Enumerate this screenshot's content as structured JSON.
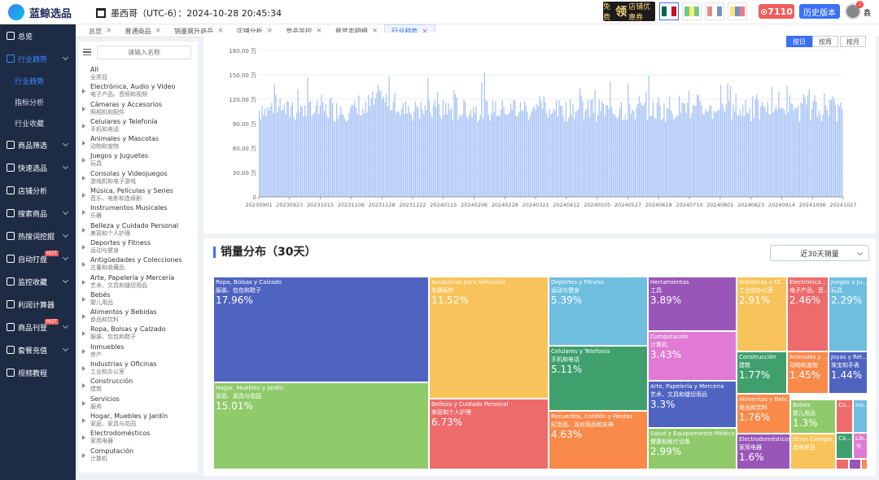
{
  "app": {
    "name": "蓝鲸选品",
    "timezone_text": "墨西哥（UTC-6）：2024-10-28 20:45:34"
  },
  "header": {
    "promo": {
      "left": "免费",
      "big": "领",
      "right": "店铺优惠券"
    },
    "coins": "7110",
    "history_button": "历史版本",
    "user": "鑫",
    "notification_count": "2",
    "flags": [
      {
        "name": "mexico-flag",
        "colors": [
          "#006847",
          "#ffffff",
          "#ce1126"
        ],
        "active": true
      },
      {
        "name": "brazil-flag",
        "colors": [
          "#009c3b",
          "#ffdf00",
          "#009c3b"
        ],
        "active": false
      },
      {
        "name": "chile-flag",
        "colors": [
          "#d52b1e",
          "#ffffff",
          "#0039a6"
        ],
        "active": false
      },
      {
        "name": "colombia-flag",
        "colors": [
          "#fcd116",
          "#003893",
          "#ce1126"
        ],
        "active": false
      }
    ]
  },
  "sidebar": {
    "items": [
      {
        "label": "总览",
        "icon": "home-icon",
        "active": false
      },
      {
        "label": "行业趋势",
        "icon": "trend-icon",
        "active": true,
        "expanded": true
      },
      {
        "label": "商品筛选",
        "icon": "filter-icon",
        "chevron": true
      },
      {
        "label": "快速选品",
        "icon": "bolt-icon",
        "chevron": true
      },
      {
        "label": "店铺分析",
        "icon": "store-icon"
      },
      {
        "label": "搜索商品",
        "icon": "search-icon",
        "chevron": true
      },
      {
        "label": "热搜词挖掘",
        "icon": "fire-icon",
        "chevron": true
      },
      {
        "label": "自动打盘",
        "icon": "auto-icon",
        "chevron": true,
        "hot": "HOT"
      },
      {
        "label": "监控收藏",
        "icon": "monitor-icon",
        "chevron": true
      },
      {
        "label": "利润计算器",
        "icon": "calculator-icon"
      },
      {
        "label": "商品刊登",
        "icon": "publish-icon",
        "chevron": true,
        "hot": "HOT"
      },
      {
        "label": "套餐充值",
        "icon": "recharge-icon",
        "chevron": true
      },
      {
        "label": "视频教程",
        "icon": "video-icon"
      }
    ],
    "subitems": [
      {
        "label": "行业趋势",
        "active": true
      },
      {
        "label": "指标分析",
        "active": false
      },
      {
        "label": "行业收藏",
        "active": false
      }
    ]
  },
  "tabs": [
    {
      "label": "总览",
      "active": false
    },
    {
      "label": "普通商品",
      "active": false
    },
    {
      "label": "销量飙升商品",
      "active": false
    },
    {
      "label": "店铺分析",
      "active": false
    },
    {
      "label": "竞品监控",
      "active": false
    },
    {
      "label": "悬赏卖明细",
      "active": false
    },
    {
      "label": "行业趋势",
      "active": true
    }
  ],
  "category_panel": {
    "search_placeholder": "请输入名称",
    "categories": [
      {
        "es": "All",
        "zh": "全类目",
        "expandable": false
      },
      {
        "es": "Electrónica, Audio y Video",
        "zh": "电子产品、音频和视频",
        "expandable": true
      },
      {
        "es": "Cámaras y Accesorios",
        "zh": "照相机和配件",
        "expandable": true
      },
      {
        "es": "Celulares y Telefonía",
        "zh": "手机和电话",
        "expandable": true
      },
      {
        "es": "Animales y Mascotas",
        "zh": "动物和宠物",
        "expandable": true
      },
      {
        "es": "Juegos y Juguetes",
        "zh": "玩具",
        "expandable": true
      },
      {
        "es": "Consolas y Videojuegos",
        "zh": "游戏机和电子游戏",
        "expandable": true
      },
      {
        "es": "Música, Películas y Series",
        "zh": "音乐、电影和连续剧",
        "expandable": true
      },
      {
        "es": "Instrumentos Musicales",
        "zh": "乐器",
        "expandable": true
      },
      {
        "es": "Belleza y Cuidado Personal",
        "zh": "美容和个人护理",
        "expandable": true
      },
      {
        "es": "Deportes y Fitness",
        "zh": "运动与健身",
        "expandable": true
      },
      {
        "es": "Antigüedades y Colecciones",
        "zh": "古董和收藏品",
        "expandable": true
      },
      {
        "es": "Arte, Papelería y Mercería",
        "zh": "艺术、文具和缝纫用品",
        "expandable": true
      },
      {
        "es": "Bebés",
        "zh": "婴儿用品",
        "expandable": true
      },
      {
        "es": "Alimentos y Bebidas",
        "zh": "食品和饮料",
        "expandable": true
      },
      {
        "es": "Ropa, Bolsas y Calzado",
        "zh": "服装、包包和鞋子",
        "expandable": true
      },
      {
        "es": "Inmuebles",
        "zh": "房产",
        "expandable": true
      },
      {
        "es": "Industrias y Oficinas",
        "zh": "工业和办公室",
        "expandable": true
      },
      {
        "es": "Construcción",
        "zh": "建筑",
        "expandable": true
      },
      {
        "es": "Servicios",
        "zh": "服务",
        "expandable": true
      },
      {
        "es": "Hogar, Muebles y Jardín",
        "zh": "家庭、家具与花园",
        "expandable": true
      },
      {
        "es": "Electrodomésticos",
        "zh": "家用电器",
        "expandable": true
      },
      {
        "es": "Computación",
        "zh": "计算机",
        "expandable": true
      }
    ]
  },
  "period_buttons": [
    {
      "label": "按日",
      "active": true
    },
    {
      "label": "按周",
      "active": false
    },
    {
      "label": "按月",
      "active": false
    }
  ],
  "chart_data": {
    "type": "bar",
    "ylim": [
      0,
      180
    ],
    "yticks": [
      0,
      30,
      60,
      90,
      120,
      150,
      180
    ],
    "ytick_labels": [
      "0",
      "30.00 万",
      "60.00 万",
      "90.00 万",
      "120.00 万",
      "150.00 万",
      "180.00 万"
    ],
    "xtick_labels": [
      "20230901",
      "20230923",
      "20231015",
      "20231106",
      "20231128",
      "20231222",
      "20240115",
      "20240206",
      "20240228",
      "20240321",
      "20240412",
      "20240505",
      "20240527",
      "20240618",
      "20240710",
      "20240801",
      "20240823",
      "20240914",
      "20241006",
      "20241027"
    ],
    "start_date": "2023-09-01",
    "end_date": "2024-10-27",
    "approx_range": [
      88,
      157
    ],
    "bar_color": "#a9c4f5",
    "note": "Daily sales volume (万), ~423 bars fluctuating between ~90 and ~150"
  },
  "treemap": {
    "title": "销量分布（30天）",
    "select_value": "近30天销量",
    "tiles": [
      {
        "es": "Ropa, Bolsas y Calzado",
        "zh": "服装、包包和鞋子",
        "pct": "17.96%",
        "color": "#4f63c0"
      },
      {
        "es": "Hogar, Muebles y Jardín",
        "zh": "家庭、家具与花园",
        "pct": "15.01%",
        "color": "#8fca6b"
      },
      {
        "es": "Accesorios para Vehículos",
        "zh": "车辆配件",
        "pct": "11.52%",
        "color": "#f7c35a"
      },
      {
        "es": "Belleza y Cuidado Personal",
        "zh": "美容和个人护理",
        "pct": "6.73%",
        "color": "#ee6b6b"
      },
      {
        "es": "Deportes y Fitness",
        "zh": "运动与健身",
        "pct": "5.39%",
        "color": "#6ebee0"
      },
      {
        "es": "Celulares y Telefonía",
        "zh": "手机和电话",
        "pct": "5.11%",
        "color": "#3fa06e"
      },
      {
        "es": "Recuerdos, Cotillón y Fiestas",
        "zh": "纪念品、派对用品和庆典",
        "pct": "4.63%",
        "color": "#f98a4a"
      },
      {
        "es": "Herramientas",
        "zh": "工具",
        "pct": "3.89%",
        "color": "#9956b8"
      },
      {
        "es": "Computación",
        "zh": "计算机",
        "pct": "3.43%",
        "color": "#e07ad3"
      },
      {
        "es": "Arte, Papelería y Mercería",
        "zh": "艺术、文具和缝纫用品",
        "pct": "3.3%",
        "color": "#4f63c0"
      },
      {
        "es": "Salud y Equipamiento Médico",
        "zh": "健康和医疗设备",
        "pct": "2.99%",
        "color": "#8fca6b"
      },
      {
        "es": "Industrias y Of...",
        "zh": "工业和办公室",
        "pct": "2.91%",
        "color": "#f7c35a"
      },
      {
        "es": "Electrónica...",
        "zh": "电子产品、音...",
        "pct": "2.46%",
        "color": "#ee6b6b"
      },
      {
        "es": "Juegos y Ju...",
        "zh": "玩具",
        "pct": "2.29%",
        "color": "#6ebee0"
      },
      {
        "es": "Construcción",
        "zh": "建筑",
        "pct": "1.77%",
        "color": "#3fa06e"
      },
      {
        "es": "Animales y ...",
        "zh": "动物和宠物",
        "pct": "1.45%",
        "color": "#f98a4a"
      },
      {
        "es": "Joyas y Rel...",
        "zh": "珠宝和手表",
        "pct": "1.44%",
        "color": "#4f63c0"
      },
      {
        "es": "Alimentos y Bebi...",
        "zh": "食品和饮料",
        "pct": "1.76%",
        "color": "#f98a4a"
      },
      {
        "es": "Bebés",
        "zh": "婴儿用品",
        "pct": "1.3%",
        "color": "#8fca6b"
      },
      {
        "es": "Electrodomésticos",
        "zh": "家用电器",
        "pct": "1.6%",
        "color": "#9956b8"
      },
      {
        "es": "Otras Categor...",
        "zh": "其他类目",
        "pct": "",
        "color": "#f7c35a"
      },
      {
        "es": "Co...",
        "zh": "",
        "pct": "",
        "color": "#ee6b6b"
      },
      {
        "es": "Ins...",
        "zh": "",
        "pct": "",
        "color": "#6ebee0"
      },
      {
        "es": "Cá...",
        "zh": "",
        "pct": "",
        "color": "#3fa06e"
      },
      {
        "es": "Lib...",
        "zh": "书",
        "pct": "",
        "color": "#e07ad3"
      },
      {
        "es": "",
        "zh": "",
        "pct": "",
        "color": "#ee6b6b"
      },
      {
        "es": "",
        "zh": "",
        "pct": "",
        "color": "#9956b8"
      },
      {
        "es": "",
        "zh": "",
        "pct": "",
        "color": "#f98a4a"
      }
    ]
  }
}
